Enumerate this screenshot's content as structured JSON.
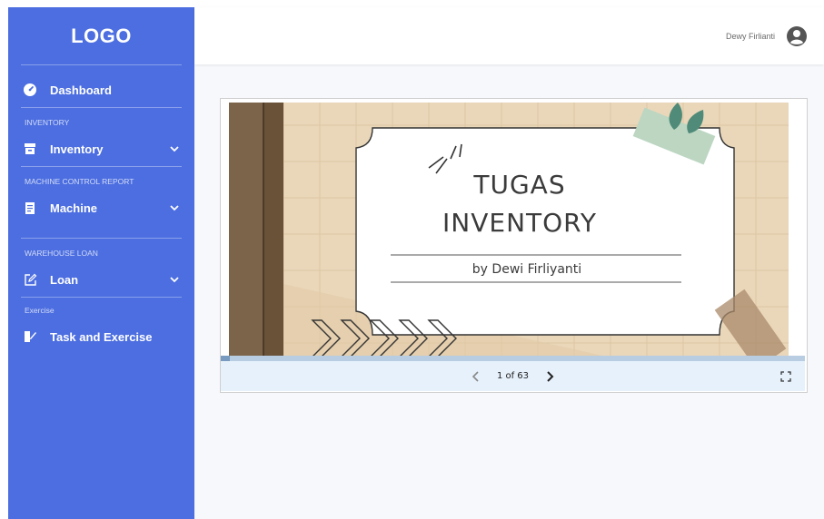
{
  "app": {
    "logo": "LOGO"
  },
  "sidebar": {
    "dashboard": {
      "label": "Dashboard",
      "icon": "speedometer-icon"
    },
    "sections": [
      {
        "title": "INVENTORY",
        "item": {
          "label": "Inventory",
          "icon": "archive-box-icon",
          "expandable": true
        }
      },
      {
        "title": "MACHINE CONTROL REPORT",
        "item": {
          "label": "Machine",
          "icon": "document-icon",
          "expandable": true
        }
      },
      {
        "title": "WAREHOUSE LOAN",
        "item": {
          "label": "Loan",
          "icon": "edit-square-icon",
          "expandable": true
        }
      },
      {
        "title": "Exercise",
        "item": {
          "label": "Task and Exercise",
          "icon": "book-pen-icon",
          "expandable": false
        }
      }
    ]
  },
  "header": {
    "user_name": "Dewy Firlianti",
    "avatar_icon": "user-circle-icon"
  },
  "viewer": {
    "slide": {
      "title_line1": "TUGAS",
      "title_line2": "INVENTORY",
      "subtitle": "by Dewi Firliyanti"
    },
    "page_indicator": "1 of 63",
    "current_page": 1,
    "total_pages": 63,
    "controls": [
      "prev-page-icon",
      "next-page-icon",
      "fullscreen-icon"
    ]
  },
  "colors": {
    "sidebar": "#4c6ee0",
    "background": "#f7f8fc",
    "slide_bg": "#e9d6b8",
    "controls_bg": "#e6f1fb"
  }
}
